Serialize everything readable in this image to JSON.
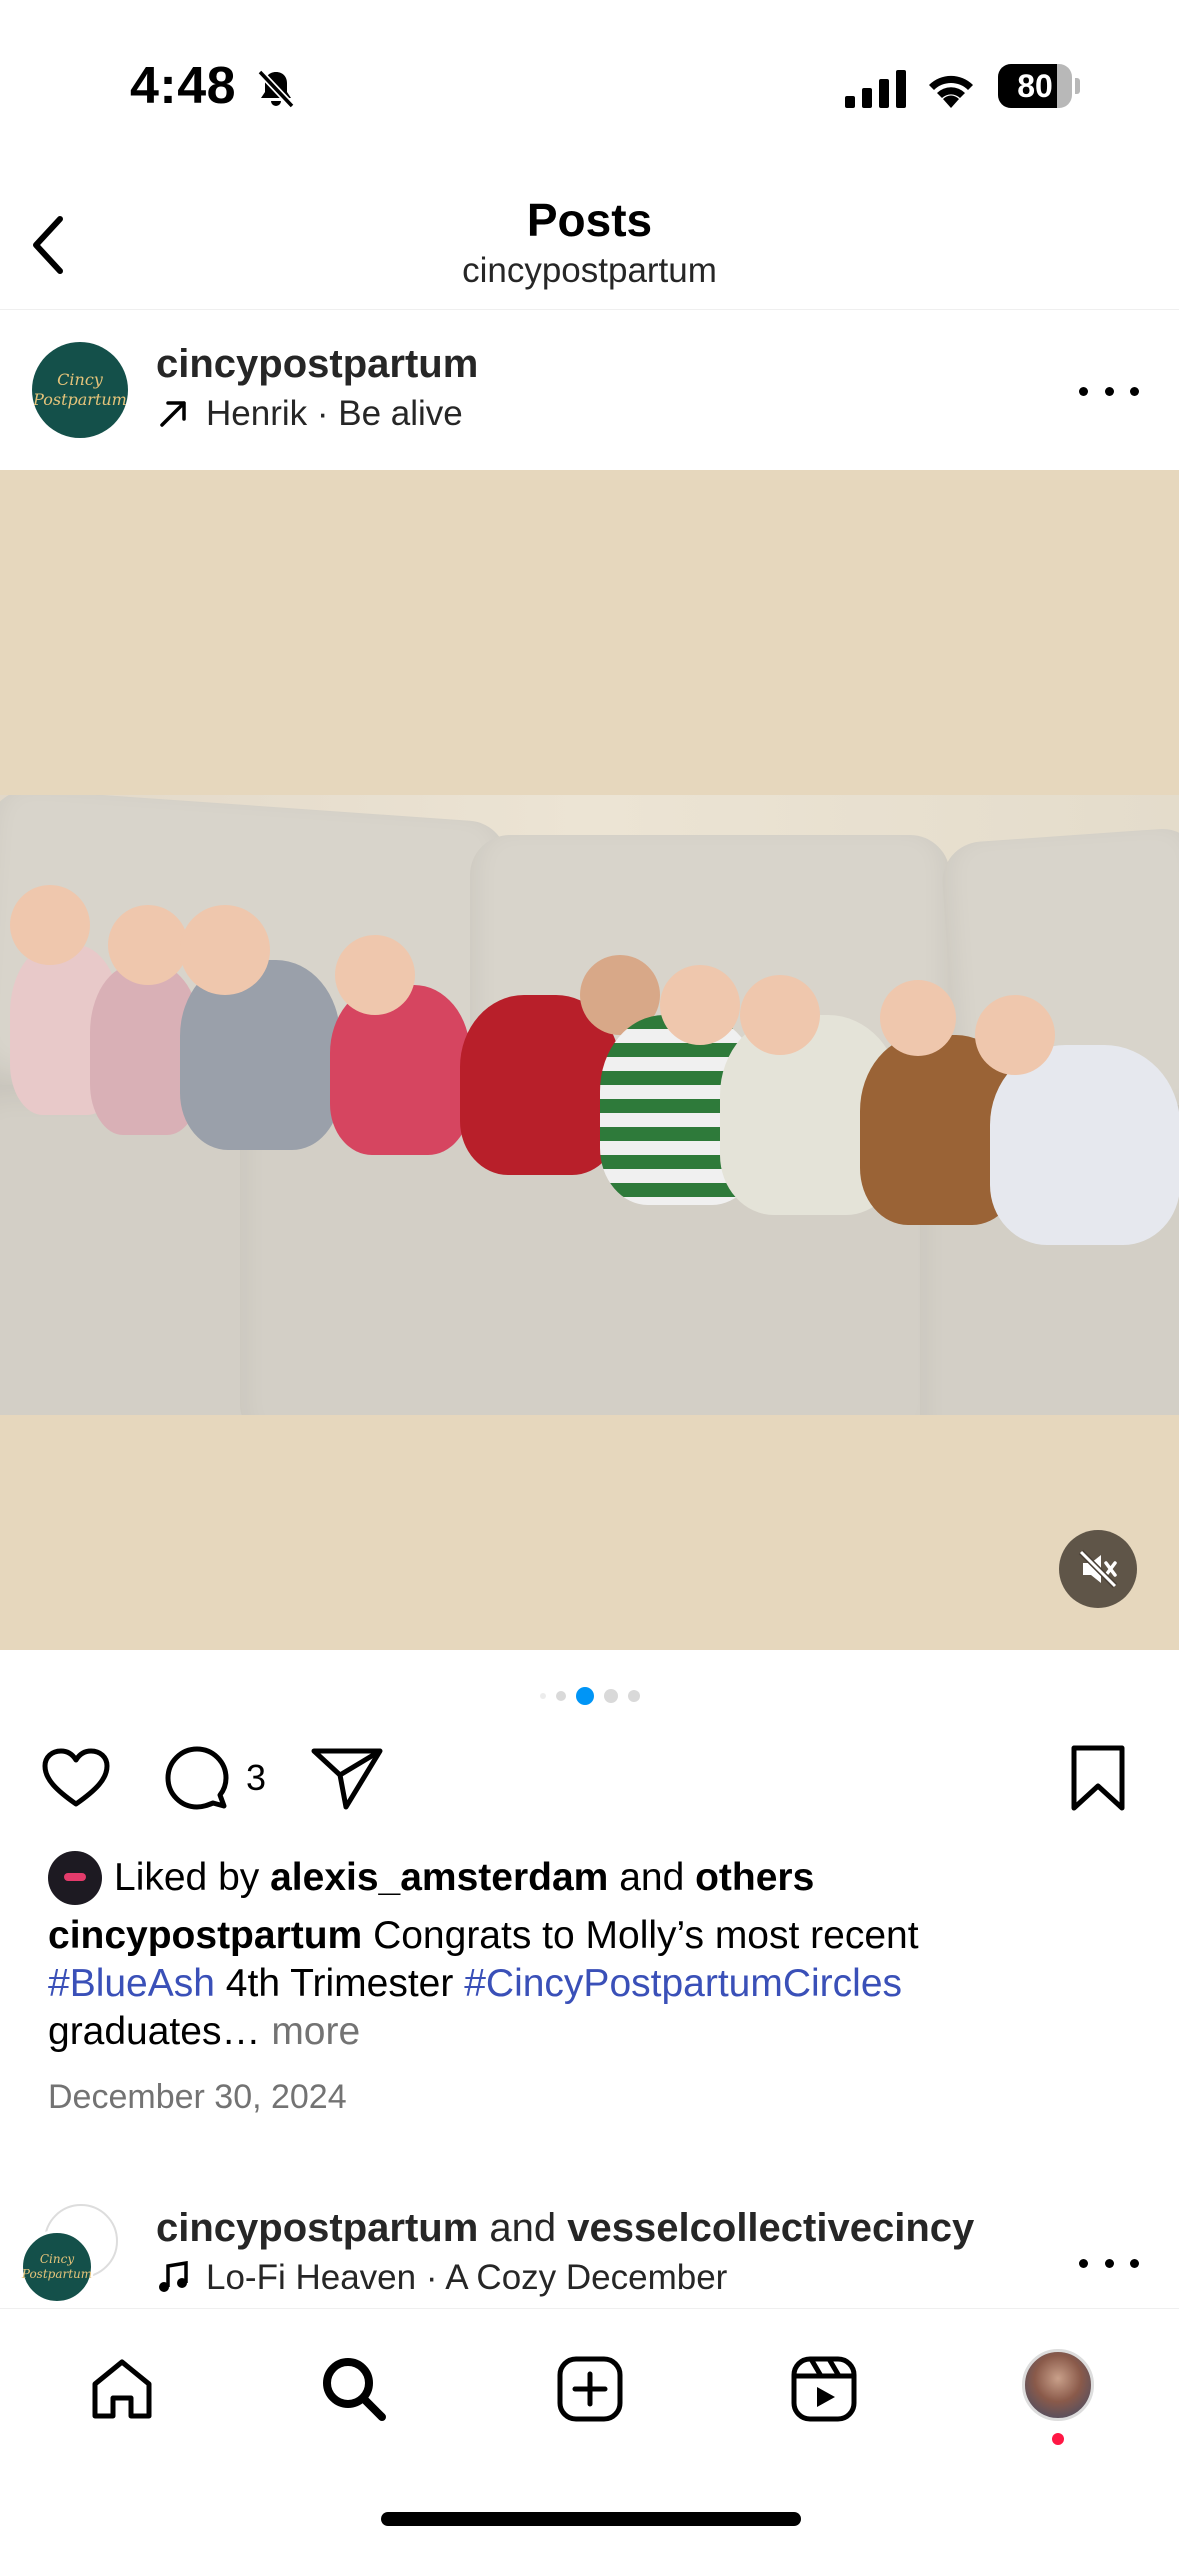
{
  "status_bar": {
    "time": "4:48",
    "battery": "80",
    "battery_level": 0.8
  },
  "header": {
    "title": "Posts",
    "subtitle": "cincypostpartum"
  },
  "post": {
    "username": "cincypostpartum",
    "audio": "Henrik · Be alive",
    "avatar_text": "Cincy Postpartum",
    "carousel": {
      "count": 5,
      "active_index": 2
    },
    "comment_count": "3",
    "liked_by_prefix": "Liked by",
    "liked_by_user": "alexis_amsterdam",
    "liked_by_and": "and",
    "liked_by_others": "others",
    "caption_user": "cincypostpartum",
    "caption_text_1": "Congrats to Molly’s most recent",
    "hashtag_1": "#BlueAsh",
    "caption_text_2": "4th Trimester",
    "hashtag_2": "#CincyPostpartumCircles",
    "caption_text_3": "graduates…",
    "more_label": "more",
    "date": "December 30, 2024"
  },
  "next_post": {
    "user_1": "cincypostpartum",
    "and_label": "and",
    "user_2": "vesselcollectivecincy",
    "audio": "Lo-Fi Heaven · A Cozy December"
  },
  "colors": {
    "accent_blue": "#0095f6",
    "hashtag": "#3a50b8",
    "notification_dot": "#ff1744",
    "media_background": "#e6d7bd"
  },
  "icons": {
    "bell": "bell-slash-icon",
    "back": "chevron-left-icon",
    "like": "heart-icon",
    "comment": "comment-bubble-icon",
    "share": "paper-plane-icon",
    "save": "bookmark-icon",
    "mute": "speaker-muted-icon",
    "tabs": [
      "home-icon",
      "search-icon",
      "create-icon",
      "reels-icon",
      "profile-avatar"
    ]
  }
}
